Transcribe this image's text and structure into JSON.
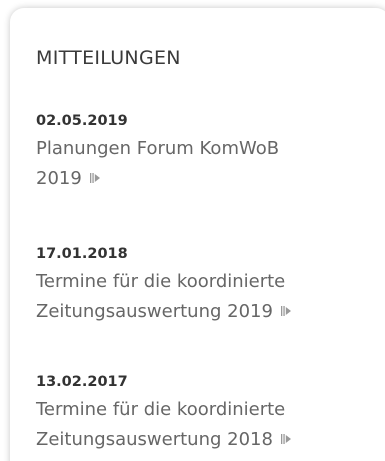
{
  "panel": {
    "heading": "MITTEILUNGEN",
    "items": [
      {
        "date": "02.05.2019",
        "title_lines": [
          "Planungen Forum KomWoB",
          "2019"
        ],
        "icon": "more-arrow-icon"
      },
      {
        "date": "17.01.2018",
        "title_lines": [
          "Termine für die koordinierte",
          "Zeitungsauswertung 2019"
        ],
        "icon": "more-arrow-icon"
      },
      {
        "date": "13.02.2017",
        "title_lines": [
          "Termine für die koordinierte",
          "Zeitungsauswertung 2018"
        ],
        "icon": "more-arrow-icon"
      }
    ]
  },
  "colors": {
    "heading": "#3a3a3a",
    "date": "#333333",
    "link": "#666666",
    "icon": "#999999"
  }
}
